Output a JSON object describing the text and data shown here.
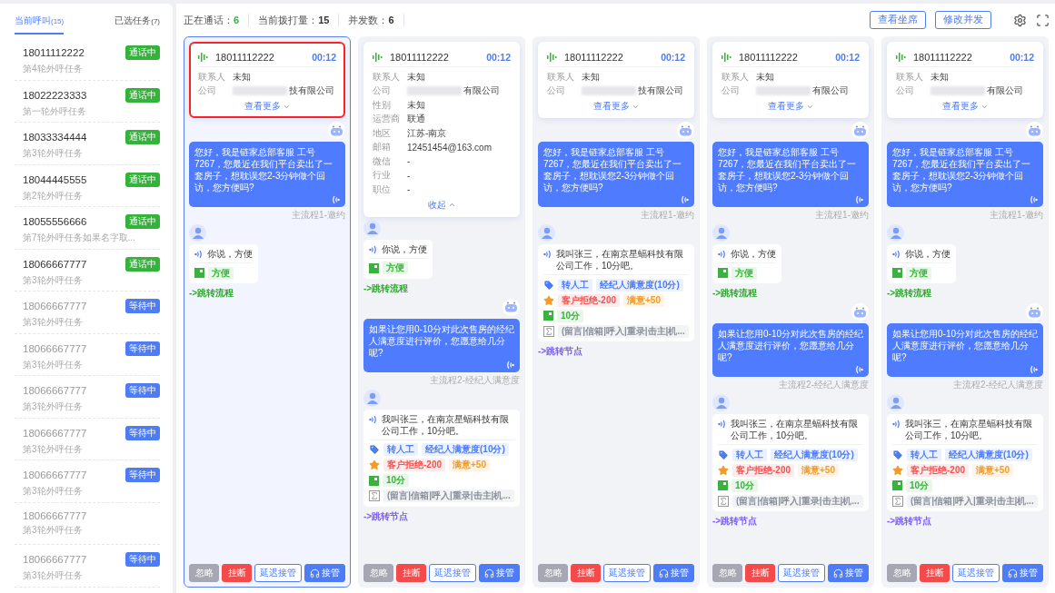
{
  "sidebar": {
    "tabs": [
      {
        "label": "当前呼叫",
        "count": "(15)",
        "selected": true
      },
      {
        "label": "已选任务",
        "count": "(7)",
        "selected": false
      }
    ],
    "items": [
      {
        "phone": "18011112222",
        "task": "第4轮外呼任务",
        "kind": "live",
        "badge": "通话中"
      },
      {
        "phone": "18022223333",
        "task": "第一轮外呼任务",
        "kind": "live",
        "badge": "通话中"
      },
      {
        "phone": "18033334444",
        "task": "第3轮外呼任务",
        "kind": "live",
        "badge": "通话中"
      },
      {
        "phone": "18044445555",
        "task": "第2轮外呼任务",
        "kind": "live",
        "badge": "通话中"
      },
      {
        "phone": "18055556666",
        "task": "第7轮外呼任务如果名字取...",
        "kind": "live",
        "badge": "通话中"
      },
      {
        "phone": "18066667777",
        "task": "第3轮外呼任务",
        "kind": "live",
        "badge": "通话中"
      },
      {
        "phone": "18066667777",
        "task": "第3轮外呼任务",
        "kind": "queued",
        "badge": "等待中"
      },
      {
        "phone": "18066667777",
        "task": "第3轮外呼任务",
        "kind": "queued",
        "badge": "等待中"
      },
      {
        "phone": "18066667777",
        "task": "第3轮外呼任务",
        "kind": "queued",
        "badge": "等待中"
      },
      {
        "phone": "18066667777",
        "task": "第3轮外呼任务",
        "kind": "queued",
        "badge": "等待中"
      },
      {
        "phone": "18066667777",
        "task": "第3轮外呼任务",
        "kind": "queued",
        "badge": "等待中"
      },
      {
        "phone": "18066667777",
        "task": "第3轮外呼任务",
        "kind": "queued"
      },
      {
        "phone": "18066667777",
        "task": "第3轮外呼任务",
        "kind": "queued",
        "badge": "等待中"
      }
    ]
  },
  "toolbar": {
    "stats": [
      {
        "label": "正在通话：",
        "value": "6",
        "highlight": true
      },
      {
        "label": "当前拨打量：",
        "value": "15",
        "highlight": false
      },
      {
        "label": "并发数：",
        "value": "6",
        "highlight": false
      }
    ],
    "buttons": [
      "查看坐席",
      "修改并发"
    ]
  },
  "columns": [
    {
      "selected": true,
      "card": {
        "phone": "18011112222",
        "duration": "00:12",
        "outlined": true,
        "expanded": false,
        "toggle": "查看更多",
        "fields": [
          {
            "label": "联系人",
            "value": "未知"
          },
          {
            "label": "公司",
            "value": "技有限公司",
            "redacted": true
          }
        ]
      },
      "messages": [
        {
          "kind": "bot",
          "text": "您好，我是链家总部客服 工号7267，您最近在我们平台卖出了一套房子，想耽误您2-3分钟做个回访，您方便吗?",
          "flow": "主流程1-邀约"
        },
        {
          "kind": "user",
          "text": "你说，方便",
          "tags": [
            {
              "kind": "intent",
              "chips": [
                {
                  "text": "方便",
                  "color": "#3bb23d"
                }
              ]
            }
          ]
        },
        {
          "kind": "jump",
          "text": "->跳转流程",
          "color": "#2fa82f"
        }
      ],
      "actions": [
        {
          "kind": "ignore",
          "label": "忽略"
        },
        {
          "kind": "hangup",
          "label": "挂断"
        },
        {
          "kind": "delay",
          "label": "延迟接管"
        },
        {
          "kind": "takeover",
          "label": "接管"
        }
      ]
    },
    {
      "selected": false,
      "card": {
        "phone": "18011112222",
        "duration": "00:12",
        "outlined": false,
        "expanded": true,
        "toggle": "收起",
        "fields": [
          {
            "label": "联系人",
            "value": "未知"
          },
          {
            "label": "公司",
            "value": "有限公司",
            "redacted": true
          },
          {
            "label": "性别",
            "value": "未知"
          },
          {
            "label": "运营商",
            "value": "联通"
          },
          {
            "label": "地区",
            "value": "江苏-南京"
          },
          {
            "label": "邮箱",
            "value": "12451454@163.com"
          },
          {
            "label": "微信",
            "value": "-"
          },
          {
            "label": "行业",
            "value": "-"
          },
          {
            "label": "职位",
            "value": "-"
          }
        ]
      },
      "messages": [
        {
          "kind": "user",
          "text": "你说，方便",
          "tags": [
            {
              "kind": "intent",
              "chips": [
                {
                  "text": "方便",
                  "color": "#3bb23d"
                }
              ]
            }
          ]
        },
        {
          "kind": "jump",
          "text": "->跳转流程",
          "color": "#2fa82f"
        },
        {
          "kind": "bot",
          "text": "如果让您用0-10分对此次售房的经纪人满意度进行评价，您愿意给几分呢?",
          "flow": "主流程2-经纪人满意度"
        },
        {
          "kind": "user",
          "text": "我叫张三，在南京星蝠科技有限公司工作，10分吧。",
          "tags": [
            {
              "kind": "label",
              "chips": [
                {
                  "text": "转人工",
                  "color": "#4d7cf6"
                },
                {
                  "text": "经纪人满意度(10分)",
                  "color": "#4d7cf6"
                }
              ]
            },
            {
              "kind": "score",
              "chips": [
                {
                  "text": "客户拒绝-200",
                  "color": "#f5504f"
                },
                {
                  "text": "满意+50",
                  "color": "#f59a23"
                }
              ]
            },
            {
              "kind": "intent",
              "chips": [
                {
                  "text": "10分",
                  "color": "#3bb23d"
                }
              ]
            },
            {
              "kind": "stat",
              "chips": [
                {
                  "text": "(留言|信箱|呼入|重录|击主|机...",
                  "color": "#8a8f9c"
                }
              ]
            }
          ]
        },
        {
          "kind": "jump",
          "text": "->跳转节点",
          "color": "#7a5ef0"
        }
      ],
      "actions": [
        {
          "kind": "ignore",
          "label": "忽略"
        },
        {
          "kind": "hangup",
          "label": "挂断"
        },
        {
          "kind": "delay",
          "label": "延迟接管"
        },
        {
          "kind": "takeover",
          "label": "接管"
        }
      ]
    },
    {
      "selected": false,
      "card": {
        "phone": "18011112222",
        "duration": "00:12",
        "outlined": false,
        "expanded": false,
        "toggle": "查看更多",
        "fields": [
          {
            "label": "联系人",
            "value": "未知"
          },
          {
            "label": "公司",
            "value": "技有限公司",
            "redacted": true
          }
        ]
      },
      "messages": [
        {
          "kind": "bot",
          "text": "您好，我是链家总部客服 工号7267，您最近在我们平台卖出了一套房子，想耽误您2-3分钟做个回访，您方便吗?",
          "flow": "主流程1-邀约"
        },
        {
          "kind": "user",
          "text": "我叫张三，在南京星蝠科技有限公司工作，10分吧。",
          "tags": [
            {
              "kind": "label",
              "chips": [
                {
                  "text": "转人工",
                  "color": "#4d7cf6"
                },
                {
                  "text": "经纪人满意度(10分)",
                  "color": "#4d7cf6"
                }
              ]
            },
            {
              "kind": "score",
              "chips": [
                {
                  "text": "客户拒绝-200",
                  "color": "#f5504f"
                },
                {
                  "text": "满意+50",
                  "color": "#f59a23"
                }
              ]
            },
            {
              "kind": "intent",
              "chips": [
                {
                  "text": "10分",
                  "color": "#3bb23d"
                }
              ]
            },
            {
              "kind": "stat",
              "chips": [
                {
                  "text": "(留言|信箱|呼入|重录|击主|机...",
                  "color": "#8a8f9c"
                }
              ]
            }
          ]
        },
        {
          "kind": "jump",
          "text": "->跳转节点",
          "color": "#7a5ef0"
        }
      ],
      "actions": [
        {
          "kind": "ignore",
          "label": "忽略"
        },
        {
          "kind": "hangup",
          "label": "挂断"
        },
        {
          "kind": "delay",
          "label": "延迟接管"
        },
        {
          "kind": "takeover",
          "label": "接管"
        }
      ]
    },
    {
      "selected": false,
      "card": {
        "phone": "18011112222",
        "duration": "00:12",
        "outlined": false,
        "expanded": false,
        "toggle": "查看更多",
        "fields": [
          {
            "label": "联系人",
            "value": "未知"
          },
          {
            "label": "公司",
            "value": "有限公司",
            "redacted": true
          }
        ]
      },
      "messages": [
        {
          "kind": "bot",
          "text": "您好，我是链家总部客服 工号7267，您最近在我们平台卖出了一套房子，想耽误您2-3分钟做个回访，您方便吗?",
          "flow": "主流程1-邀约"
        },
        {
          "kind": "user",
          "text": "你说，方便",
          "tags": [
            {
              "kind": "intent",
              "chips": [
                {
                  "text": "方便",
                  "color": "#3bb23d"
                }
              ]
            }
          ]
        },
        {
          "kind": "jump",
          "text": "->跳转流程",
          "color": "#2fa82f"
        },
        {
          "kind": "bot",
          "text": "如果让您用0-10分对此次售房的经纪人满意度进行评价，您愿意给几分呢?",
          "flow": "主流程2-经纪人满意度"
        },
        {
          "kind": "user",
          "text": "我叫张三，在南京星蝠科技有限公司工作，10分吧。",
          "tags": [
            {
              "kind": "label",
              "chips": [
                {
                  "text": "转人工",
                  "color": "#4d7cf6"
                },
                {
                  "text": "经纪人满意度(10分)",
                  "color": "#4d7cf6"
                }
              ]
            },
            {
              "kind": "score",
              "chips": [
                {
                  "text": "客户拒绝-200",
                  "color": "#f5504f"
                },
                {
                  "text": "满意+50",
                  "color": "#f59a23"
                }
              ]
            },
            {
              "kind": "intent",
              "chips": [
                {
                  "text": "10分",
                  "color": "#3bb23d"
                }
              ]
            },
            {
              "kind": "stat",
              "chips": [
                {
                  "text": "(留言|信箱|呼入|重录|击主|机...",
                  "color": "#8a8f9c"
                }
              ]
            }
          ]
        },
        {
          "kind": "jump",
          "text": "->跳转节点",
          "color": "#7a5ef0"
        }
      ],
      "actions": [
        {
          "kind": "ignore",
          "label": "忽略"
        },
        {
          "kind": "hangup",
          "label": "挂断"
        },
        {
          "kind": "delay",
          "label": "延迟接管"
        },
        {
          "kind": "takeover",
          "label": "接管"
        }
      ]
    },
    {
      "selected": false,
      "card": {
        "phone": "18011112222",
        "duration": "00:12",
        "outlined": false,
        "expanded": false,
        "toggle": "查看更多",
        "fields": [
          {
            "label": "联系人",
            "value": "未知"
          },
          {
            "label": "公司",
            "value": "有限公司",
            "redacted": true
          }
        ]
      },
      "messages": [
        {
          "kind": "bot",
          "text": "您好，我是链家总部客服 工号7267，您最近在我们平台卖出了一套房子，想耽误您2-3分钟做个回访，您方便吗?",
          "flow": "主流程1-邀约"
        },
        {
          "kind": "user",
          "text": "你说，方便",
          "tags": [
            {
              "kind": "intent",
              "chips": [
                {
                  "text": "方便",
                  "color": "#3bb23d"
                }
              ]
            }
          ]
        },
        {
          "kind": "jump",
          "text": "->跳转流程",
          "color": "#2fa82f"
        },
        {
          "kind": "bot",
          "text": "如果让您用0-10分对此次售房的经纪人满意度进行评价，您愿意给几分呢?",
          "flow": "主流程2-经纪人满意度"
        },
        {
          "kind": "user",
          "text": "我叫张三，在南京星蝠科技有限公司工作，10分吧。",
          "tags": [
            {
              "kind": "label",
              "chips": [
                {
                  "text": "转人工",
                  "color": "#4d7cf6"
                },
                {
                  "text": "经纪人满意度(10分)",
                  "color": "#4d7cf6"
                }
              ]
            },
            {
              "kind": "score",
              "chips": [
                {
                  "text": "客户拒绝-200",
                  "color": "#f5504f"
                },
                {
                  "text": "满意+50",
                  "color": "#f59a23"
                }
              ]
            },
            {
              "kind": "intent",
              "chips": [
                {
                  "text": "10分",
                  "color": "#3bb23d"
                }
              ]
            },
            {
              "kind": "stat",
              "chips": [
                {
                  "text": "(留言|信箱|呼入|重录|击主|机...",
                  "color": "#8a8f9c"
                }
              ]
            }
          ]
        },
        {
          "kind": "jump",
          "text": "->跳转节点",
          "color": "#7a5ef0"
        }
      ],
      "actions": [
        {
          "kind": "ignore",
          "label": "忽略"
        },
        {
          "kind": "hangup",
          "label": "挂断"
        },
        {
          "kind": "delay",
          "label": "延迟接管"
        },
        {
          "kind": "takeover",
          "label": "接管"
        }
      ]
    }
  ]
}
